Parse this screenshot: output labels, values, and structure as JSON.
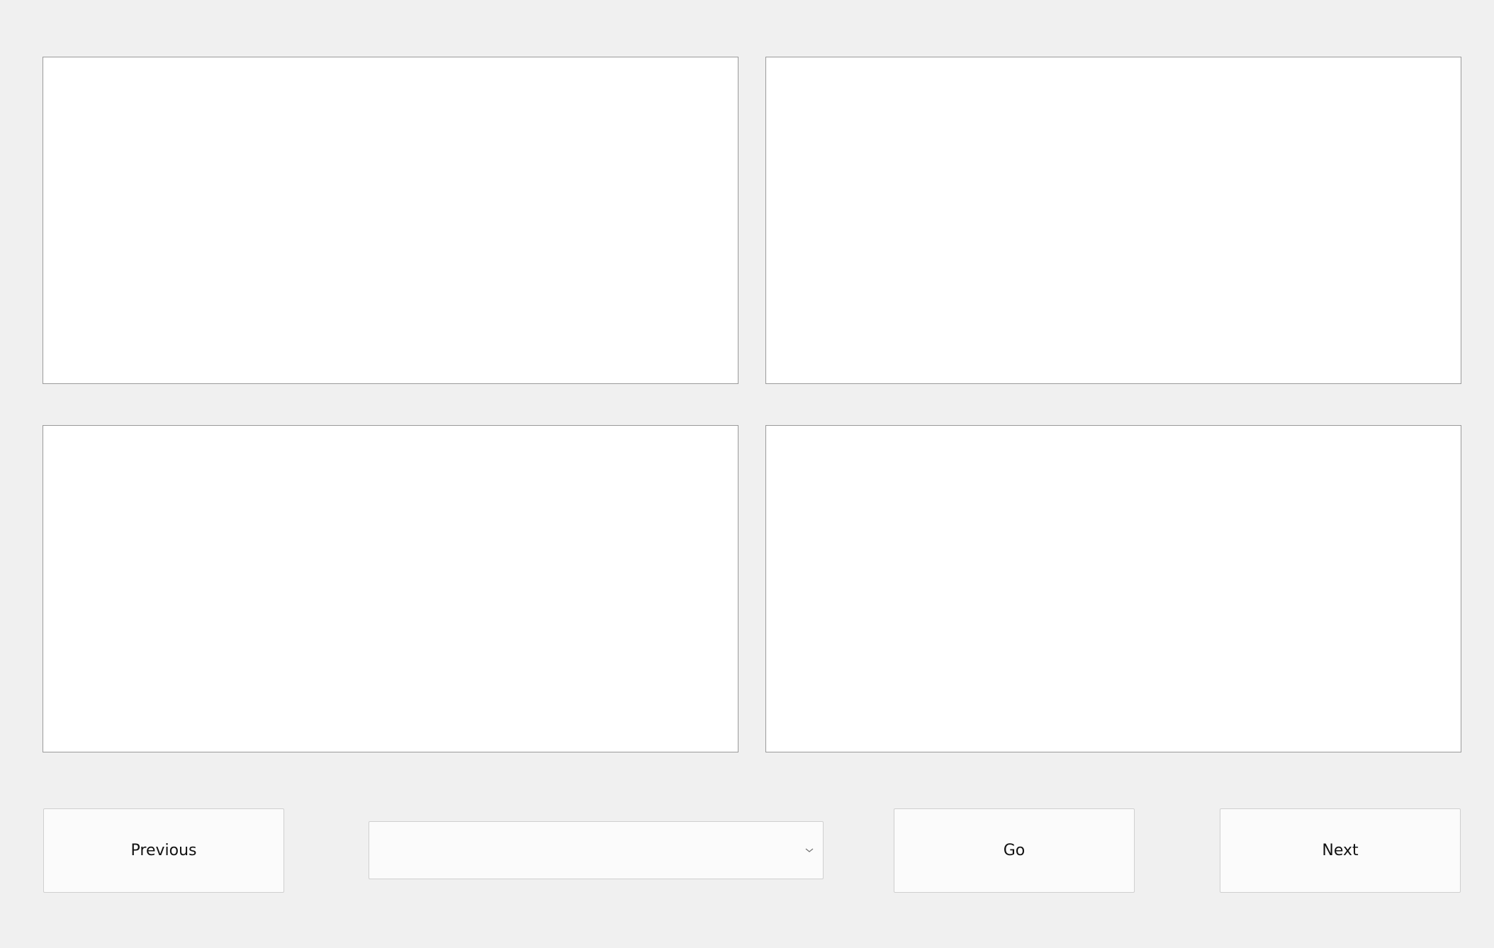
{
  "panels": [
    {
      "id": "panel-1",
      "content": ""
    },
    {
      "id": "panel-2",
      "content": ""
    },
    {
      "id": "panel-3",
      "content": ""
    },
    {
      "id": "panel-4",
      "content": ""
    }
  ],
  "controls": {
    "previous_label": "Previous",
    "go_label": "Go",
    "next_label": "Next",
    "select_value": "",
    "select_icon": "chevron-down-icon"
  },
  "colors": {
    "background": "#f0f0f0",
    "panel": "#ffffff",
    "panel_border": "#9a9a9a",
    "button": "#fbfbfb",
    "button_border": "#cfcfcf"
  }
}
